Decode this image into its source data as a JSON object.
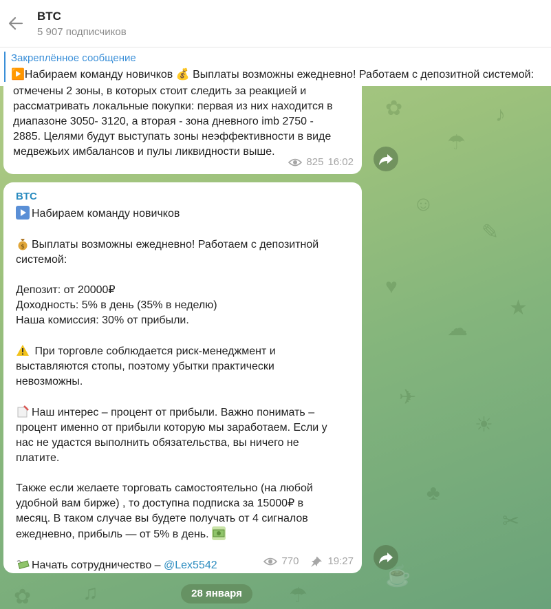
{
  "header": {
    "channel_name": "BTC",
    "subscribers": "5 907 подписчиков"
  },
  "pinned": {
    "title": "Закреплённое сообщение",
    "text": "▶️Набираем команду новичков   💰 Выплаты возможны ежедневно! Работаем с депозитной системой:"
  },
  "message1": {
    "lines": [
      "отмечены 2 зоны, в которых стоит следить за реакцией и",
      "рассматривать локальные покупки: первая из них находится в",
      "диапазоне 3050- 3120, а вторая - зона дневного imb 2750 -",
      "2885. Целями будут выступать зоны неэффективности в виде",
      "медвежьих имбалансов и пулы ликвидности выше."
    ],
    "views": "825",
    "time": "16:02"
  },
  "message2": {
    "sender": "BTC",
    "l1": "Набираем команду новичков",
    "l2a": "Выплаты возможны ежедневно! Работаем с депозитной",
    "l2b": "системой:",
    "l3": "Депозит: от 20000₽",
    "l4": "Доходность: 5% в день (35% в неделю)",
    "l5": "Наша комиссия: 30% от прибыли.",
    "l6a": " При торговле соблюдается риск-менеджмент и",
    "l6b": "выставляются стопы, поэтому убытки практически",
    "l6c": "невозможны.",
    "l7a": "Наш интерес – процент от прибыли. Важно понимать –",
    "l7b": "процент именно от прибыли которую мы заработаем. Если у",
    "l7c": "нас не удастся выполнить обязательства, вы ничего не",
    "l7d": "платите.",
    "l8a": "Также если желаете торговать самостоятельно (на любой",
    "l8b": "удобной вам бирже) , то доступна подписка за 15000₽ в",
    "l8c": "месяц. В таком случае вы будете получать от 4 сигналов",
    "l8d": "ежедневно, прибыль — от 5% в день.",
    "l9": "Начать сотрудничество – ",
    "link": "@Lex5542",
    "views": "770",
    "time": "19:27"
  },
  "date_chip": "28 января",
  "colors": {
    "accent": "#2a8bbf",
    "pinned_accent": "#3a8fd8",
    "meta_gray": "#a6a6a6"
  },
  "icons": [
    "back-arrow-icon",
    "eye-icon",
    "pin-icon",
    "share-icon",
    "play-icon",
    "money-bag-icon",
    "warning-icon",
    "memo-icon",
    "money-wings-icon",
    "dollar-banknote-icon"
  ]
}
